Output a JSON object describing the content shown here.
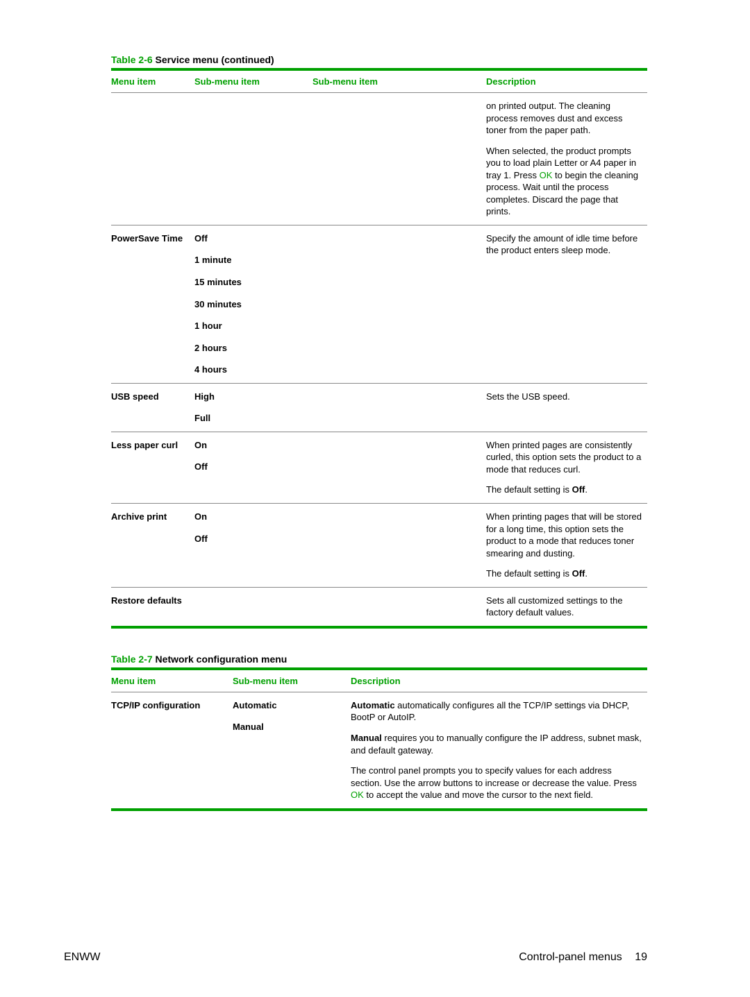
{
  "table1": {
    "caption_num": "Table 2-6",
    "caption_title": "  Service menu (continued)",
    "headers": {
      "h1": "Menu item",
      "h2": "Sub-menu item",
      "h3": "Sub-menu item",
      "h4": "Description"
    },
    "row0": {
      "desc_p1": "on printed output. The cleaning process removes dust and excess toner from the paper path.",
      "desc_p2a": "When selected, the product prompts you to load plain Letter or A4 paper in tray 1. Press ",
      "ok": "OK",
      "desc_p2b": " to begin the cleaning process. Wait until the process completes. Discard the page that prints."
    },
    "row1": {
      "menu": "PowerSave Time",
      "opts": {
        "o1": "Off",
        "o2": "1 minute",
        "o3": "15 minutes",
        "o4": "30 minutes",
        "o5": "1 hour",
        "o6": "2 hours",
        "o7": "4 hours"
      },
      "desc": "Specify the amount of idle time before the product enters sleep mode."
    },
    "row2": {
      "menu": "USB speed",
      "opts": {
        "o1": "High",
        "o2": "Full"
      },
      "desc": "Sets the USB speed."
    },
    "row3": {
      "menu": "Less paper curl",
      "opts": {
        "o1": "On",
        "o2": "Off"
      },
      "desc_p1": "When printed pages are consistently curled, this option sets the product to a mode that reduces curl.",
      "desc_p2a": "The default setting is ",
      "off": "Off",
      "desc_p2b": "."
    },
    "row4": {
      "menu": "Archive print",
      "opts": {
        "o1": "On",
        "o2": "Off"
      },
      "desc_p1": "When printing pages that will be stored for a long time, this option sets the product to a mode that reduces toner smearing and dusting.",
      "desc_p2a": "The default setting is ",
      "off": "Off",
      "desc_p2b": "."
    },
    "row5": {
      "menu": "Restore defaults",
      "desc": "Sets all customized settings to the factory default values."
    }
  },
  "table2": {
    "caption_num": "Table 2-7",
    "caption_title": "  Network configuration menu",
    "headers": {
      "h1": "Menu item",
      "h2": "Sub-menu item",
      "h3": "Description"
    },
    "row0": {
      "menu": "TCP/IP configuration",
      "opts": {
        "o1": "Automatic",
        "o2": "Manual"
      },
      "p1_b": "Automatic",
      "p1_t": " automatically configures all the TCP/IP settings via DHCP, BootP or AutoIP.",
      "p2_b": "Manual",
      "p2_t": " requires you to manually configure the IP address, subnet mask, and default gateway.",
      "p3_a": "The control panel prompts you to specify values for each address section. Use the arrow buttons to increase or decrease the value. Press ",
      "ok": "OK",
      "p3_b": " to accept the value and move the cursor to the next field."
    }
  },
  "footer": {
    "left": "ENWW",
    "right_label": "Control-panel menus",
    "page_num": "19"
  }
}
